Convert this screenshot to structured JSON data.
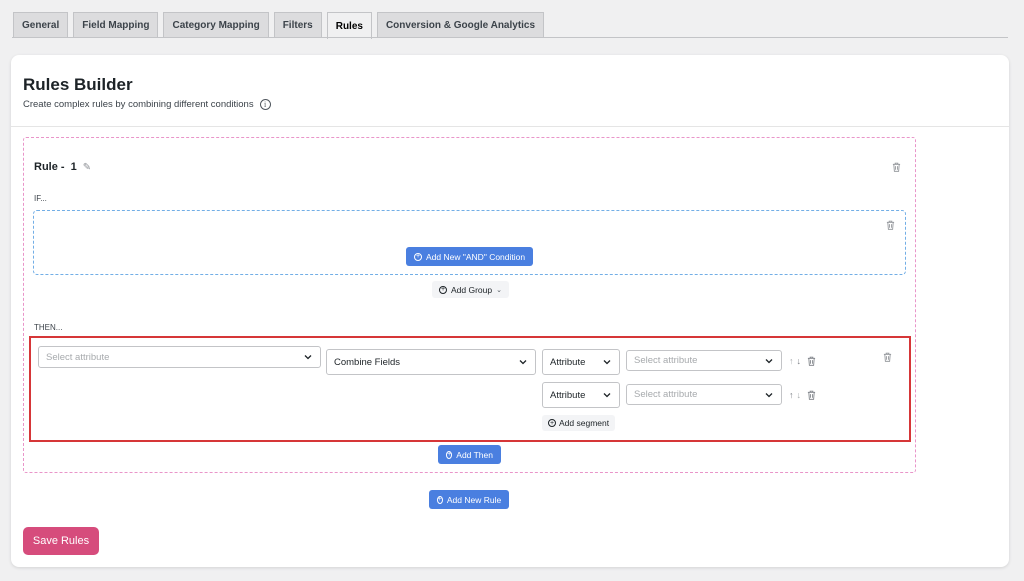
{
  "tabs": [
    {
      "label": "General"
    },
    {
      "label": "Field Mapping"
    },
    {
      "label": "Category Mapping"
    },
    {
      "label": "Filters"
    },
    {
      "label": "Rules",
      "active": true
    },
    {
      "label": "Conversion & Google Analytics"
    }
  ],
  "builder": {
    "title": "Rules Builder",
    "subtitle": "Create complex rules by combining different conditions",
    "info_icon": "i"
  },
  "rule": {
    "label": "Rule -",
    "number": "1",
    "if_label": "IF...",
    "then_label": "THEN...",
    "add_and_condition": "Add New \"AND\" Condition",
    "add_group": "Add Group",
    "then_row": {
      "target_placeholder": "Select attribute",
      "action_value": "Combine Fields",
      "segments": [
        {
          "type_value": "Attribute",
          "attribute_placeholder": "Select attribute"
        },
        {
          "type_value": "Attribute",
          "attribute_placeholder": "Select attribute"
        }
      ],
      "add_segment": "Add segment"
    },
    "add_then": "Add Then"
  },
  "add_new_rule": "Add New Rule",
  "save_rules": "Save Rules",
  "colors": {
    "primary_button": "#4a7fe0",
    "save_button": "#d64c7c",
    "highlight_border": "#d63638",
    "rule_border": "#e995c9",
    "if_border": "#72aee6"
  },
  "icons": {
    "pencil": "✎",
    "arrow_up": "↑",
    "arrow_down": "↓",
    "chevron": "⌄",
    "plus": "+"
  }
}
